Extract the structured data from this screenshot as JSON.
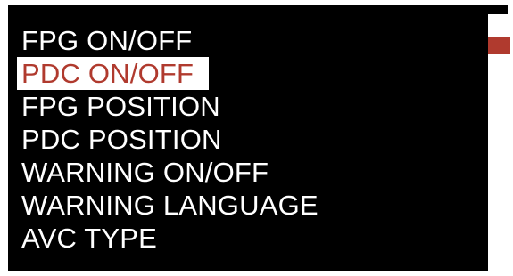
{
  "menu": {
    "items": [
      {
        "label": "FPG ON/OFF"
      },
      {
        "label": "PDC ON/OFF"
      },
      {
        "label": "FPG POSITION"
      },
      {
        "label": "PDC POSITION"
      },
      {
        "label": "WARNING ON/OFF"
      },
      {
        "label": "WARNING LANGUAGE"
      },
      {
        "label": "AVC TYPE"
      }
    ],
    "selected_index": 1
  },
  "scroll": {
    "position_fraction": 0.12
  },
  "colors": {
    "background": "#000000",
    "text": "#ffffff",
    "highlight_bg": "#ffffff",
    "accent": "#b03a2e"
  }
}
